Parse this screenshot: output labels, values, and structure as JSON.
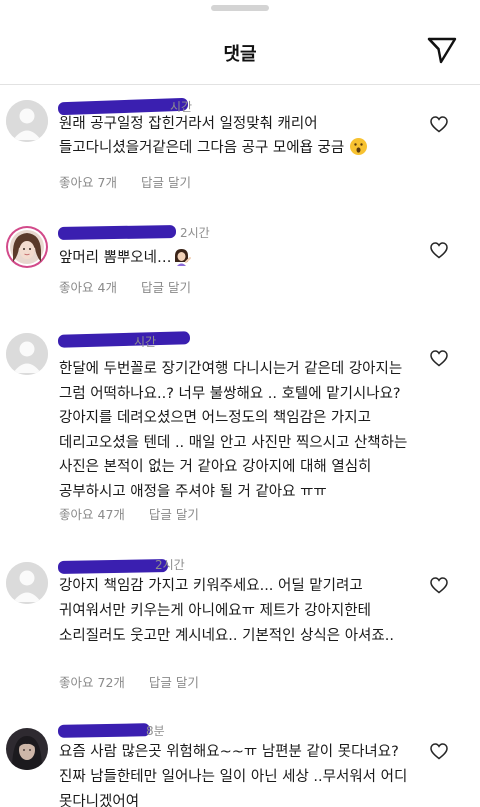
{
  "header": {
    "title": "댓글"
  },
  "comments": [
    {
      "time": "시간",
      "text": "원래 공구일정 잡힌거라서 일정맞춰 캐리어 들고다니셨을거같은데 그다음 공구 모에욥 궁금",
      "emoji": "😮",
      "likes_label": "좋아요",
      "likes_count": "7개",
      "reply_label": "답글 달기"
    },
    {
      "time": "2시간",
      "text": "앞머리 뽐뿌오네…",
      "emoji": "💁‍♀️",
      "likes_label": "좋아요",
      "likes_count": "4개",
      "reply_label": "답글 달기"
    },
    {
      "time": "시간",
      "text": "한달에 두번꼴로 장기간여행 다니시는거 같은데 강아지는 그럼 어떡하나요..? 너무 불쌍해요 .. 호텔에 맡기시나요? 강아지를 데려오셨으면 어느정도의 책임감은 가지고 데리고오셨을 텐데 .. 매일 안고 사진만 찍으시고 산책하는 사진은 본적이 없는 거 같아요 강아지에 대해 열심히 공부하시고 애정을 주셔야 될 거 같아요 ㅠㅠ",
      "likes_label": "좋아요",
      "likes_count": "47개",
      "reply_label": "답글 달기"
    },
    {
      "time": "2시간",
      "text": "강아지 책임감 가지고 키워주세요... 어딜 맡기려고 귀여워서만 키우는게 아니에요ㅠ 제트가 강아지한테 소리질러도 웃고만 계시네요.. 기본적인 상식은 아셔죠..",
      "likes_label": "좋아요",
      "likes_count": "72개",
      "reply_label": "답글 달기"
    },
    {
      "time": "8분",
      "text": "요즘 사람 많은곳 위험해요~~ㅠ 남편분 같이 못다녀요? 진짜 남들한테만 일어나는 일이 아닌 세상 ..무서워서 어디 못다니겠어여"
    }
  ],
  "icons": {
    "send": "paper-plane-icon",
    "like": "heart-outline-icon",
    "avatar_default": "default-avatar-icon"
  },
  "colors": {
    "username_redaction": "#3a1fb0",
    "muted_text": "#8e8e8e"
  }
}
